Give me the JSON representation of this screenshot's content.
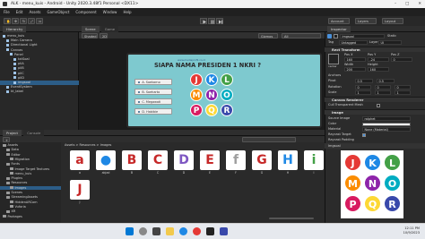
{
  "window": {
    "title": "ALK - menu_kuis - Android - Unity 2020.3.48f1 Personal <DX11>",
    "min": "–",
    "max": "□",
    "close": "✕"
  },
  "menu": [
    "File",
    "Edit",
    "Assets",
    "GameObject",
    "Component",
    "Window",
    "Help"
  ],
  "toolbar": {
    "account": "Account",
    "layers": "Layers",
    "layout": "Layout"
  },
  "hierarchy": {
    "tab": "Hierarchy",
    "items": [
      {
        "label": "menu_kuis",
        "indent": 0
      },
      {
        "label": "Main Camera",
        "indent": 1
      },
      {
        "label": "Directional Light",
        "indent": 1
      },
      {
        "label": "Canvas",
        "indent": 1
      },
      {
        "label": "Panel",
        "indent": 2
      },
      {
        "label": "txtSoal",
        "indent": 3
      },
      {
        "label": "pilA",
        "indent": 3
      },
      {
        "label": "pilB",
        "indent": 3
      },
      {
        "label": "pilC",
        "indent": 3
      },
      {
        "label": "pilD",
        "indent": 3
      },
      {
        "label": "imgsoal",
        "indent": 3,
        "selected": true
      },
      {
        "label": "EventSystem",
        "indent": 1
      },
      {
        "label": "kt_label",
        "indent": 1
      }
    ]
  },
  "scene": {
    "tabs": [
      "Scene",
      "Game"
    ],
    "shading": "Shaded",
    "mode": "2D",
    "gizmos": "Gizmos",
    "search": "All",
    "question": "SIAPA NAMA PRESIDEN 1 NKRI ?",
    "subtitle": "www.mediaprofil.co.id",
    "answers": [
      "A. Soekarno",
      "B. Soeharto",
      "C. Megawati",
      "D. Habibie"
    ],
    "tiles": [
      {
        "letter": "J",
        "color": "#e53935"
      },
      {
        "letter": "K",
        "color": "#1e88e5"
      },
      {
        "letter": "L",
        "color": "#43a047"
      },
      {
        "letter": "M",
        "color": "#fb8c00"
      },
      {
        "letter": "N",
        "color": "#8e24aa"
      },
      {
        "letter": "O",
        "color": "#00acc1"
      },
      {
        "letter": "P",
        "color": "#d81b60"
      },
      {
        "letter": "Q",
        "color": "#fdd835"
      },
      {
        "letter": "R",
        "color": "#3949ab"
      }
    ]
  },
  "inspector": {
    "tab": "Inspector",
    "object_name": "imgsoal",
    "static_label": "Static",
    "tag_label": "Tag",
    "tag_value": "Untagged",
    "layer_label": "Layer",
    "layer_value": "UI",
    "rect_transform": "Rect Transform",
    "anchor_label": "center",
    "pos_x_label": "Pos X",
    "pos_y_label": "Pos Y",
    "pos_z_label": "Pos Z",
    "pos_x": "160",
    "pos_y": "-24",
    "pos_z": "0",
    "width_label": "Width",
    "height_label": "Height",
    "width": "200",
    "height": "160",
    "anchors": "Anchors",
    "pivot_label": "Pivot",
    "pivot_x": "0.5",
    "pivot_y": "0.5",
    "rotation_label": "Rotation",
    "rotation": [
      "0",
      "0",
      "0"
    ],
    "scale_label": "Scale",
    "scale": [
      "1",
      "1",
      "1"
    ],
    "canvas_renderer": "Canvas Renderer",
    "cull_label": "Cull Transparent Mesh",
    "image": "Image",
    "source_image_label": "Source Image",
    "source_image": "ralphet",
    "color_label": "Color",
    "material_label": "Material",
    "material": "None (Material)",
    "raycast_label": "Raycast Target",
    "raycast_padding": "Raycast Padding",
    "preview_label": "Imgsoal",
    "preview_tiles": [
      {
        "letter": "J",
        "color": "#e53935"
      },
      {
        "letter": "K",
        "color": "#1e88e5"
      },
      {
        "letter": "L",
        "color": "#43a047"
      },
      {
        "letter": "M",
        "color": "#fb8c00"
      },
      {
        "letter": "N",
        "color": "#8e24aa"
      },
      {
        "letter": "O",
        "color": "#00acc1"
      },
      {
        "letter": "P",
        "color": "#d81b60"
      },
      {
        "letter": "Q",
        "color": "#fdd835"
      },
      {
        "letter": "R",
        "color": "#3949ab"
      }
    ]
  },
  "project": {
    "tabs": [
      "Project",
      "Console"
    ],
    "breadcrumb": "Assets > Resources > Images",
    "tree": [
      {
        "label": "Assets",
        "indent": 0
      },
      {
        "label": "Data",
        "indent": 1
      },
      {
        "label": "Editor",
        "indent": 1
      },
      {
        "label": "Migration",
        "indent": 2
      },
      {
        "label": "Fonts",
        "indent": 1
      },
      {
        "label": "Image Target Textures",
        "indent": 2
      },
      {
        "label": "menu_kuis",
        "indent": 2
      },
      {
        "label": "Plugins",
        "indent": 1
      },
      {
        "label": "Resources",
        "indent": 1
      },
      {
        "label": "Images",
        "indent": 2,
        "selected": true
      },
      {
        "label": "Scenes",
        "indent": 1
      },
      {
        "label": "StreamingAssets",
        "indent": 1
      },
      {
        "label": "HiddenARCom",
        "indent": 2
      },
      {
        "label": "Vuforia",
        "indent": 2
      },
      {
        "label": "XR",
        "indent": 1
      },
      {
        "label": "Packages",
        "indent": 0
      }
    ],
    "assets": [
      {
        "glyph": "a",
        "label": "a",
        "bg": "#ffffff",
        "fg": "#c62828"
      },
      {
        "glyph": "●",
        "label": "abjad",
        "bg": "#ffffff",
        "fg": "#1e88e5"
      },
      {
        "glyph": "B",
        "label": "B",
        "bg": "#ffffff",
        "fg": "#c62828"
      },
      {
        "glyph": "C",
        "label": "C",
        "bg": "#ffffff",
        "fg": "#c62828"
      },
      {
        "glyph": "D",
        "label": "D",
        "bg": "#ffffff",
        "fg": "#7e57c2"
      },
      {
        "glyph": "E",
        "label": "E",
        "bg": "#ffffff",
        "fg": "#c62828"
      },
      {
        "glyph": "f",
        "label": "F",
        "bg": "#ffffff",
        "fg": "#9e9e9e"
      },
      {
        "glyph": "G",
        "label": "G",
        "bg": "#ffffff",
        "fg": "#c62828"
      },
      {
        "glyph": "H",
        "label": "H",
        "bg": "#ffffff",
        "fg": "#1e88e5"
      },
      {
        "glyph": "i",
        "label": "I",
        "bg": "#ffffff",
        "fg": "#43a047"
      },
      {
        "glyph": "J",
        "label": "J",
        "bg": "#ffffff",
        "fg": "#c62828"
      }
    ]
  },
  "taskbar": {
    "time": "12:11 PM",
    "date": "10/9/2023"
  }
}
